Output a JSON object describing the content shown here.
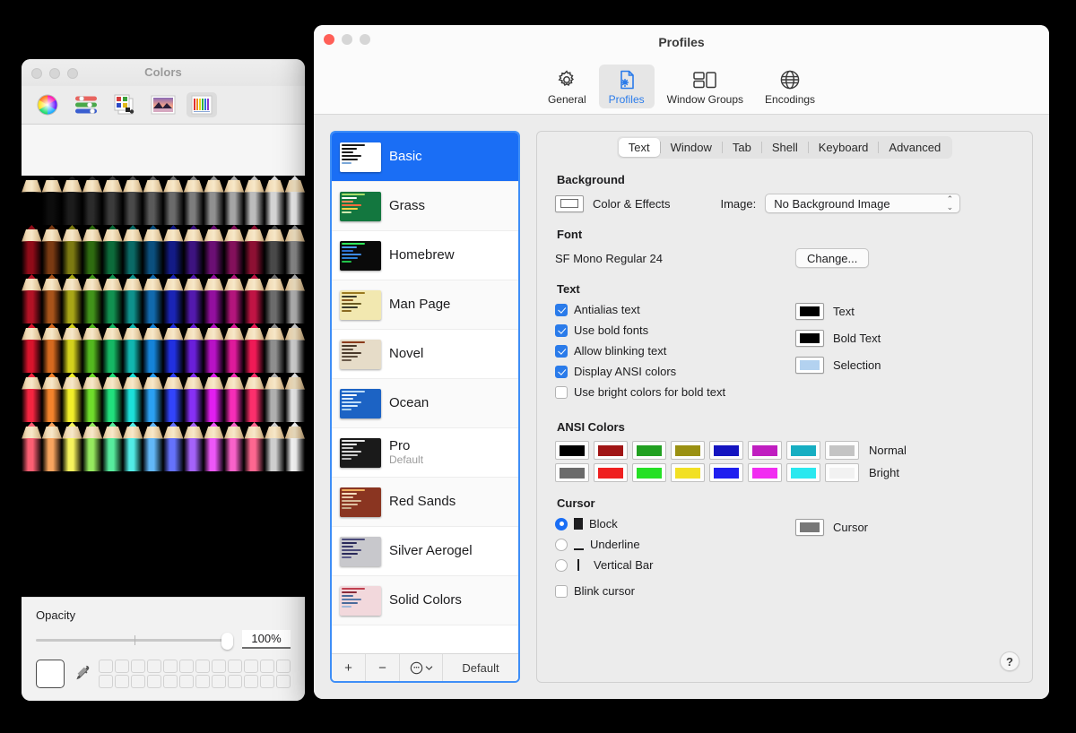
{
  "colors_panel": {
    "title": "Colors",
    "toolbar": [
      {
        "name": "color-wheel-tool",
        "selected": false
      },
      {
        "name": "color-sliders-tool",
        "selected": false
      },
      {
        "name": "color-palettes-tool",
        "selected": false
      },
      {
        "name": "image-palettes-tool",
        "selected": false
      },
      {
        "name": "pencils-tool",
        "selected": true
      }
    ],
    "opacity_label": "Opacity",
    "opacity_value": "100%",
    "pencil_rows": [
      [
        "#000000",
        "#0d0d0d",
        "#1c1c1c",
        "#2b2b2b",
        "#3b3b3b",
        "#4a4a4a",
        "#5a5a5a",
        "#6b6b6b",
        "#7d7d7d",
        "#909090",
        "#a5a5a5",
        "#bcbcbc",
        "#d4d4d4",
        "#ededed"
      ],
      [
        "#8f0b18",
        "#7a3a12",
        "#7c7a11",
        "#2e6b10",
        "#0c6b3a",
        "#0a6a66",
        "#0b4f7e",
        "#131b86",
        "#3d1380",
        "#6b0f74",
        "#83105b",
        "#8d1033",
        "#4a4a4a",
        "#8a8a8a"
      ],
      [
        "#b21225",
        "#a8531a",
        "#a8a616",
        "#41931a",
        "#119150",
        "#0e918c",
        "#1169ad",
        "#1a24b5",
        "#5319ae",
        "#930f9f",
        "#b3157c",
        "#c01444",
        "#6d6d6d",
        "#b5b5b5"
      ],
      [
        "#d8142c",
        "#d5691f",
        "#d4d11c",
        "#53b81f",
        "#15b864",
        "#11b6b0",
        "#1583d8",
        "#2130e0",
        "#6a1fda",
        "#b812c6",
        "#de1a9b",
        "#ef1a56",
        "#8f8f8f",
        "#d6d6d6"
      ],
      [
        "#f42540",
        "#f3832c",
        "#f2ef29",
        "#6fdd2b",
        "#21e07d",
        "#1ce0da",
        "#2ba0f2",
        "#3244fb",
        "#8730f5",
        "#e21ef0",
        "#f62db8",
        "#fc2f6c",
        "#b0b0b0",
        "#f0f0f0"
      ],
      [
        "#fb5f73",
        "#f8a45f",
        "#f6f35d",
        "#95e95f",
        "#57ec9e",
        "#52ece7",
        "#62b7f8",
        "#6572fc",
        "#a563f9",
        "#ec57f7",
        "#f862c9",
        "#fd6790",
        "#cfcfcf",
        "#ffffff"
      ]
    ]
  },
  "profiles_window": {
    "title": "Profiles",
    "toolbar": [
      {
        "label": "General",
        "icon": "gear-icon",
        "active": false
      },
      {
        "label": "Profiles",
        "icon": "document-gear-icon",
        "active": true
      },
      {
        "label": "Window Groups",
        "icon": "window-groups-icon",
        "active": false
      },
      {
        "label": "Encodings",
        "icon": "globe-icon",
        "active": false
      }
    ],
    "profiles": [
      {
        "name": "Basic",
        "sub": "",
        "selected": true,
        "thumb": {
          "bg": "#ffffff",
          "lines": [
            "#1a1a1a",
            "#000000",
            "#1a1a1a",
            "#1a1a1a",
            "#1a1a1a",
            "#7aa7d8"
          ]
        }
      },
      {
        "name": "Grass",
        "sub": "",
        "selected": false,
        "thumb": {
          "bg": "#13773f",
          "lines": [
            "#a8e06a",
            "#ffffff",
            "#ff8a5c",
            "#ff6b3d",
            "#ffd24a",
            "#cfeab0"
          ]
        }
      },
      {
        "name": "Homebrew",
        "sub": "",
        "selected": false,
        "thumb": {
          "bg": "#0a0a0a",
          "lines": [
            "#2ee85a",
            "#4a9df8",
            "#2b6fd0",
            "#3f8ae0",
            "#2e7fd4",
            "#21c44a"
          ]
        }
      },
      {
        "name": "Man Page",
        "sub": "",
        "selected": false,
        "thumb": {
          "bg": "#f2e8b0",
          "lines": [
            "#9a7a20",
            "#3a3a2a",
            "#8a5a20",
            "#6a5a20",
            "#3a3a2a",
            "#8a6a20"
          ]
        }
      },
      {
        "name": "Novel",
        "sub": "",
        "selected": false,
        "thumb": {
          "bg": "#e6dcc8",
          "lines": [
            "#8a3a1a",
            "#4a3a2a",
            "#5a4a3a",
            "#4a3a2a",
            "#5a4a3a",
            "#6a5a4a"
          ]
        }
      },
      {
        "name": "Ocean",
        "sub": "",
        "selected": false,
        "thumb": {
          "bg": "#1c63c4",
          "lines": [
            "#bcdcf8",
            "#ffffff",
            "#d8ecff",
            "#bcdcf8",
            "#d8ecff",
            "#a8d0f0"
          ]
        }
      },
      {
        "name": "Pro",
        "sub": "Default",
        "selected": false,
        "thumb": {
          "bg": "#1a1a1a",
          "lines": [
            "#e8e8e8",
            "#ffffff",
            "#c8c8c8",
            "#d8d8d8",
            "#c8c8c8",
            "#b8b8b8"
          ]
        }
      },
      {
        "name": "Red Sands",
        "sub": "",
        "selected": false,
        "thumb": {
          "bg": "#8a3521",
          "lines": [
            "#f0b060",
            "#f8e0c0",
            "#e8c8a8",
            "#d8b898",
            "#e0c0a0",
            "#c8a888"
          ]
        }
      },
      {
        "name": "Silver Aerogel",
        "sub": "",
        "selected": false,
        "thumb": {
          "bg": "#c8c8cc",
          "lines": [
            "#4a4a7a",
            "#2a2a5a",
            "#3a3a6a",
            "#4a4a7a",
            "#2a2a5a",
            "#5a5a8a"
          ]
        }
      },
      {
        "name": "Solid Colors",
        "sub": "",
        "selected": false,
        "thumb": {
          "bg": "#f2d8dc",
          "lines": [
            "#c04050",
            "#8a2a3a",
            "#4a6a9a",
            "#5a7aaa",
            "#4a6a9a",
            "#a0b8d8"
          ]
        }
      }
    ],
    "sidebar_footer": {
      "add_label": "+",
      "remove_label": "−",
      "more_label": "⋯",
      "default_label": "Default"
    },
    "tabs": [
      {
        "label": "Text",
        "active": true
      },
      {
        "label": "Window",
        "active": false
      },
      {
        "label": "Tab",
        "active": false
      },
      {
        "label": "Shell",
        "active": false
      },
      {
        "label": "Keyboard",
        "active": false
      },
      {
        "label": "Advanced",
        "active": false
      }
    ],
    "background": {
      "section_title": "Background",
      "color_effects_label": "Color & Effects",
      "image_label": "Image:",
      "image_value": "No Background Image",
      "well_color": "#ffffff"
    },
    "font": {
      "section_title": "Font",
      "value": "SF Mono Regular 24",
      "change_label": "Change..."
    },
    "text": {
      "section_title": "Text",
      "checkboxes": [
        {
          "label": "Antialias text",
          "checked": true
        },
        {
          "label": "Use bold fonts",
          "checked": true
        },
        {
          "label": "Allow blinking text",
          "checked": true
        },
        {
          "label": "Display ANSI colors",
          "checked": true
        },
        {
          "label": "Use bright colors for bold text",
          "checked": false
        }
      ],
      "wells": [
        {
          "label": "Text",
          "color": "#000000"
        },
        {
          "label": "Bold Text",
          "color": "#000000"
        },
        {
          "label": "Selection",
          "color": "#b3d2f0"
        }
      ]
    },
    "ansi": {
      "section_title": "ANSI Colors",
      "normal_label": "Normal",
      "bright_label": "Bright",
      "normal": [
        "#000000",
        "#a01515",
        "#21a021",
        "#9a9012",
        "#1414c0",
        "#c01ec0",
        "#16aec2",
        "#c4c4c4"
      ],
      "bright": [
        "#6b6b6b",
        "#ef2020",
        "#25e025",
        "#f2e024",
        "#1f1fef",
        "#f12cf1",
        "#2ae8ef",
        "#f2f2f2"
      ]
    },
    "cursor": {
      "section_title": "Cursor",
      "options": [
        {
          "label": "Block",
          "glyph": "block",
          "selected": true
        },
        {
          "label": "Underline",
          "glyph": "underline",
          "selected": false
        },
        {
          "label": "Vertical Bar",
          "glyph": "bar",
          "selected": false
        }
      ],
      "blink_label": "Blink cursor",
      "blink_checked": false,
      "well_label": "Cursor",
      "well_color": "#787878"
    },
    "help_label": "?"
  }
}
